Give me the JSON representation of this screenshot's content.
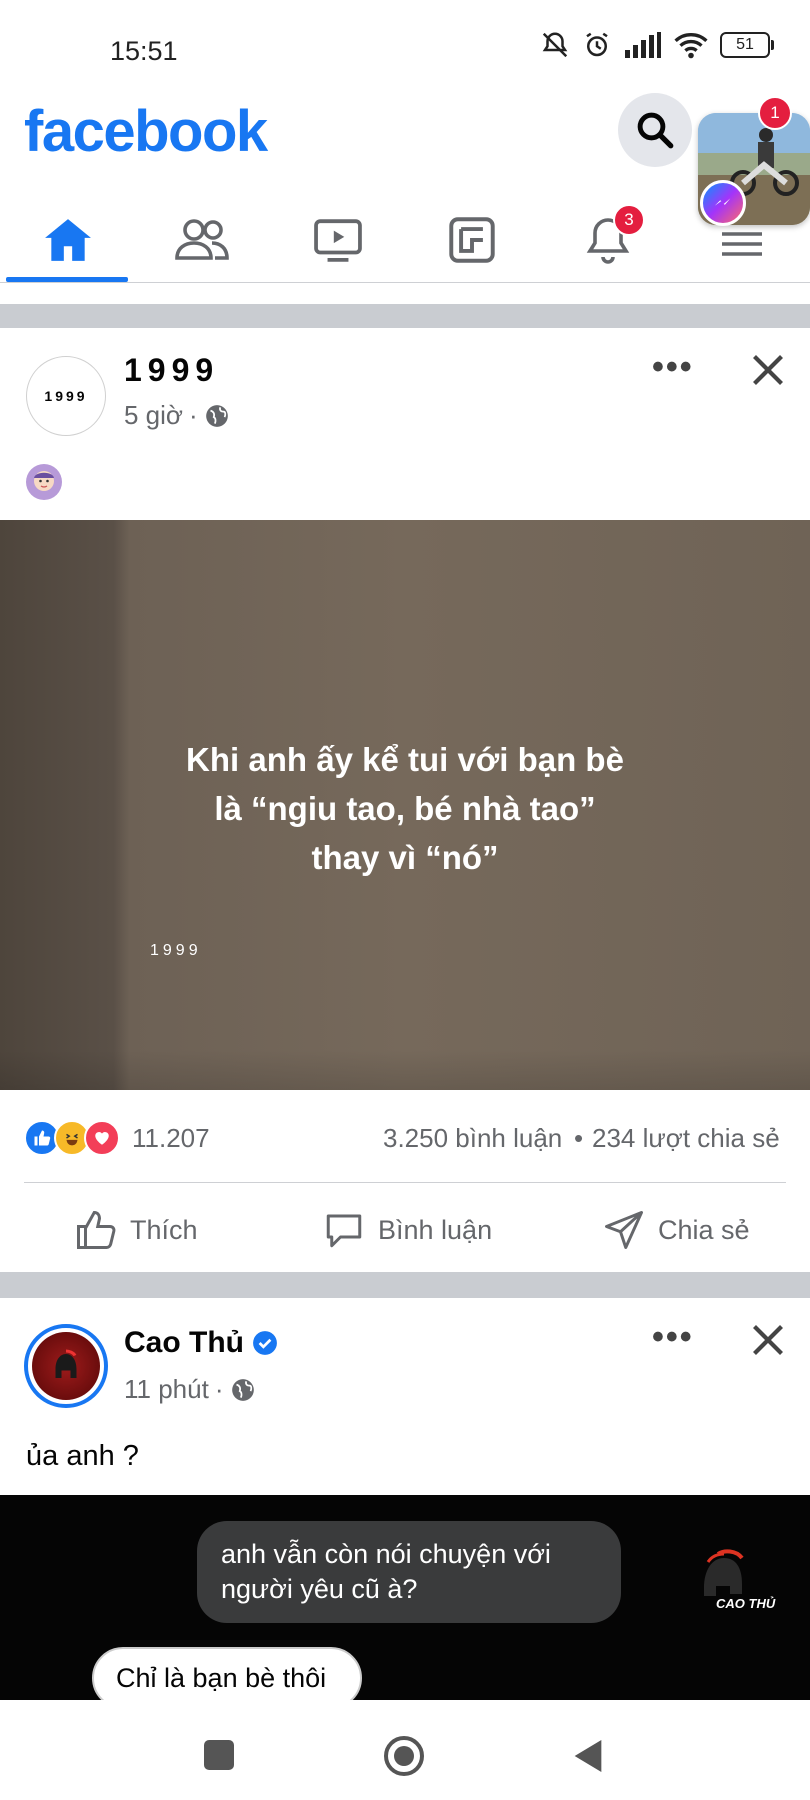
{
  "status_bar": {
    "time": "15:51",
    "battery": "51"
  },
  "header": {
    "logo": "facebook",
    "chat_badge": "1"
  },
  "nav": {
    "notifications_badge": "3",
    "active_tab": "home"
  },
  "post1": {
    "author": "1999",
    "avatar_text": "1999",
    "time": "5 giờ",
    "image_text": [
      "Khi anh ấy kể tui với bạn bè",
      "là “ngiu tao, bé nhà tao”",
      "thay vì “nó”"
    ],
    "watermark": "1999",
    "reactions_count": "11.207",
    "comments": "3.250 bình luận",
    "shares": "234 lượt chia sẻ",
    "actions": {
      "like": "Thích",
      "comment": "Bình luận",
      "share": "Chia sẻ"
    }
  },
  "post2": {
    "author": "Cao Thủ",
    "time": "11 phút",
    "text": "ủa anh ?",
    "bubble_1": "anh vẫn còn nói chuyện với người yêu cũ à?",
    "bubble_2": "Chỉ là bạn bè thôi",
    "logo_text": "CAO THỦ"
  },
  "colors": {
    "brand": "#1877f2",
    "badge": "#e41e3f",
    "secondary_text": "#65676b"
  }
}
